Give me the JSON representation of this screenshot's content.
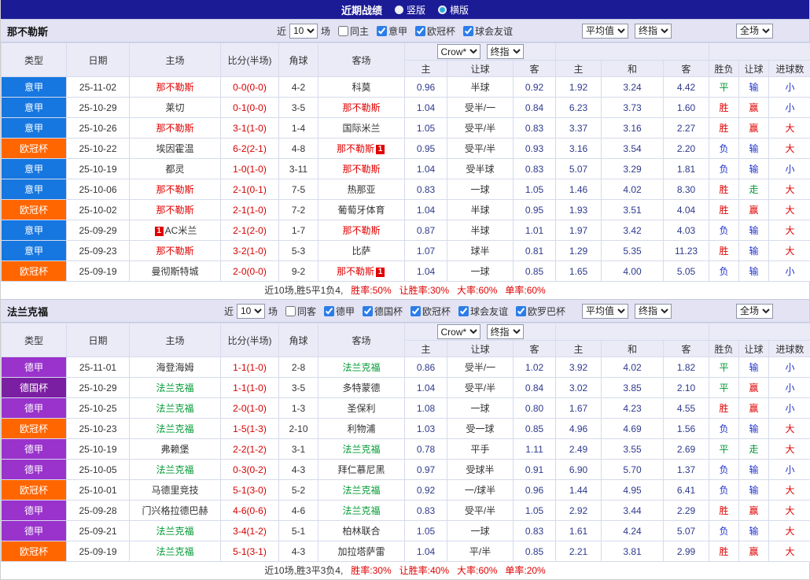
{
  "topbar": {
    "title": "近期战绩",
    "radio_vertical": "竖版",
    "radio_horizontal": "横版",
    "selected": "横版"
  },
  "colors": {
    "topbar-bg": "#1b1b96",
    "band-bg": "#e3e3f4",
    "header-bg": "#ebebf8",
    "border": "#c3c9e0",
    "grid": "#d6dbec",
    "red": "#e00000",
    "blue": "#2233cc",
    "green": "#009933",
    "score": "#d40000",
    "odds": "#2e3a8c",
    "radio-dot": "#2aa9e0"
  },
  "league_colors": {
    "意甲": "#1677e0",
    "欧冠杯": "#ff6600",
    "德甲": "#9933cc",
    "德国杯": "#7b1fa2"
  },
  "columns": {
    "main": [
      "类型",
      "日期",
      "主场",
      "比分(半场)",
      "角球",
      "客场"
    ],
    "sub": [
      "主",
      "让球",
      "客",
      "主",
      "和",
      "客",
      "胜负",
      "让球",
      "进球数"
    ]
  },
  "sections": [
    {
      "team": "那不勒斯",
      "focus_color": "#e00000",
      "filters": {
        "near": "近",
        "count": "10",
        "games": "场",
        "checks": [
          {
            "label": "同主",
            "checked": false
          },
          {
            "label": "意甲",
            "checked": true
          },
          {
            "label": "欧冠杯",
            "checked": true
          },
          {
            "label": "球会友谊",
            "checked": true
          }
        ]
      },
      "selects": {
        "odds_source": "Crow*",
        "odds_stage": "终指",
        "avg": "平均值",
        "avg_stage": "终指",
        "scope": "全场"
      },
      "rows": [
        {
          "league": "意甲",
          "date": "25-11-02",
          "home": "那不勒斯",
          "home_focus": true,
          "score": "0-0(0-0)",
          "corner": "4-2",
          "away": "科莫",
          "odds": [
            "0.96",
            "半球",
            "0.92"
          ],
          "avg": [
            "1.92",
            "3.24",
            "4.42"
          ],
          "results": [
            "平",
            "输",
            "小"
          ]
        },
        {
          "league": "意甲",
          "date": "25-10-29",
          "home": "莱切",
          "score": "0-1(0-0)",
          "corner": "3-5",
          "away": "那不勒斯",
          "away_focus": true,
          "odds": [
            "1.04",
            "受半/一",
            "0.84"
          ],
          "avg": [
            "6.23",
            "3.73",
            "1.60"
          ],
          "results": [
            "胜",
            "赢",
            "小"
          ]
        },
        {
          "league": "意甲",
          "date": "25-10-26",
          "home": "那不勒斯",
          "home_focus": true,
          "score": "3-1(1-0)",
          "corner": "1-4",
          "away": "国际米兰",
          "odds": [
            "1.05",
            "受平/半",
            "0.83"
          ],
          "avg": [
            "3.37",
            "3.16",
            "2.27"
          ],
          "results": [
            "胜",
            "赢",
            "大"
          ]
        },
        {
          "league": "欧冠杯",
          "date": "25-10-22",
          "home": "埃因霍温",
          "score": "6-2(2-1)",
          "corner": "4-8",
          "away": "那不勒斯",
          "away_focus": true,
          "away_badge": "1",
          "odds": [
            "0.95",
            "受平/半",
            "0.93"
          ],
          "avg": [
            "3.16",
            "3.54",
            "2.20"
          ],
          "results": [
            "负",
            "输",
            "大"
          ]
        },
        {
          "league": "意甲",
          "date": "25-10-19",
          "home": "都灵",
          "score": "1-0(1-0)",
          "corner": "3-11",
          "away": "那不勒斯",
          "away_focus": true,
          "odds": [
            "1.04",
            "受半球",
            "0.83"
          ],
          "avg": [
            "5.07",
            "3.29",
            "1.81"
          ],
          "results": [
            "负",
            "输",
            "小"
          ]
        },
        {
          "league": "意甲",
          "date": "25-10-06",
          "home": "那不勒斯",
          "home_focus": true,
          "score": "2-1(0-1)",
          "corner": "7-5",
          "away": "热那亚",
          "odds": [
            "0.83",
            "一球",
            "1.05"
          ],
          "avg": [
            "1.46",
            "4.02",
            "8.30"
          ],
          "results": [
            "胜",
            "走",
            "大"
          ]
        },
        {
          "league": "欧冠杯",
          "date": "25-10-02",
          "home": "那不勒斯",
          "home_focus": true,
          "score": "2-1(1-0)",
          "corner": "7-2",
          "away": "葡萄牙体育",
          "odds": [
            "1.04",
            "半球",
            "0.95"
          ],
          "avg": [
            "1.93",
            "3.51",
            "4.04"
          ],
          "results": [
            "胜",
            "赢",
            "大"
          ]
        },
        {
          "league": "意甲",
          "date": "25-09-29",
          "home": "AC米兰",
          "home_badge": "1",
          "home_badge_pos": "before",
          "score": "2-1(2-0)",
          "corner": "1-7",
          "away": "那不勒斯",
          "away_focus": true,
          "odds": [
            "0.87",
            "半球",
            "1.01"
          ],
          "avg": [
            "1.97",
            "3.42",
            "4.03"
          ],
          "results": [
            "负",
            "输",
            "大"
          ]
        },
        {
          "league": "意甲",
          "date": "25-09-23",
          "home": "那不勒斯",
          "home_focus": true,
          "score": "3-2(1-0)",
          "corner": "5-3",
          "away": "比萨",
          "odds": [
            "1.07",
            "球半",
            "0.81"
          ],
          "avg": [
            "1.29",
            "5.35",
            "11.23"
          ],
          "results": [
            "胜",
            "输",
            "大"
          ]
        },
        {
          "league": "欧冠杯",
          "date": "25-09-19",
          "home": "曼彻斯特城",
          "score": "2-0(0-0)",
          "corner": "9-2",
          "away": "那不勒斯",
          "away_focus": true,
          "away_badge": "1",
          "odds": [
            "1.04",
            "一球",
            "0.85"
          ],
          "avg": [
            "1.65",
            "4.00",
            "5.05"
          ],
          "results": [
            "负",
            "输",
            "小"
          ]
        }
      ],
      "summary": {
        "prefix": "近10场,胜5平1负4,",
        "rates": [
          "胜率:50%",
          "让胜率:30%",
          "大率:60%",
          "单率:60%"
        ]
      }
    },
    {
      "team": "法兰克福",
      "focus_color": "#009933",
      "filters": {
        "near": "近",
        "count": "10",
        "games": "场",
        "checks": [
          {
            "label": "同客",
            "checked": false
          },
          {
            "label": "德甲",
            "checked": true
          },
          {
            "label": "德国杯",
            "checked": true
          },
          {
            "label": "欧冠杯",
            "checked": true
          },
          {
            "label": "球会友谊",
            "checked": true
          },
          {
            "label": "欧罗巴杯",
            "checked": true
          }
        ]
      },
      "selects": {
        "odds_source": "Crow*",
        "odds_stage": "终指",
        "avg": "平均值",
        "avg_stage": "终指",
        "scope": "全场"
      },
      "rows": [
        {
          "league": "德甲",
          "date": "25-11-01",
          "home": "海登海姆",
          "score": "1-1(1-0)",
          "corner": "2-8",
          "away": "法兰克福",
          "away_focus": true,
          "odds": [
            "0.86",
            "受半/一",
            "1.02"
          ],
          "avg": [
            "3.92",
            "4.02",
            "1.82"
          ],
          "results": [
            "平",
            "输",
            "小"
          ]
        },
        {
          "league": "德国杯",
          "date": "25-10-29",
          "home": "法兰克福",
          "home_focus": true,
          "score": "1-1(1-0)",
          "corner": "3-5",
          "away": "多特蒙德",
          "odds": [
            "1.04",
            "受平/半",
            "0.84"
          ],
          "avg": [
            "3.02",
            "3.85",
            "2.10"
          ],
          "results": [
            "平",
            "赢",
            "小"
          ]
        },
        {
          "league": "德甲",
          "date": "25-10-25",
          "home": "法兰克福",
          "home_focus": true,
          "score": "2-0(1-0)",
          "corner": "1-3",
          "away": "圣保利",
          "odds": [
            "1.08",
            "一球",
            "0.80"
          ],
          "avg": [
            "1.67",
            "4.23",
            "4.55"
          ],
          "results": [
            "胜",
            "赢",
            "小"
          ]
        },
        {
          "league": "欧冠杯",
          "date": "25-10-23",
          "home": "法兰克福",
          "home_focus": true,
          "score": "1-5(1-3)",
          "corner": "2-10",
          "away": "利物浦",
          "odds": [
            "1.03",
            "受一球",
            "0.85"
          ],
          "avg": [
            "4.96",
            "4.69",
            "1.56"
          ],
          "results": [
            "负",
            "输",
            "大"
          ]
        },
        {
          "league": "德甲",
          "date": "25-10-19",
          "home": "弗赖堡",
          "score": "2-2(1-2)",
          "corner": "3-1",
          "away": "法兰克福",
          "away_focus": true,
          "odds": [
            "0.78",
            "平手",
            "1.11"
          ],
          "avg": [
            "2.49",
            "3.55",
            "2.69"
          ],
          "results": [
            "平",
            "走",
            "大"
          ]
        },
        {
          "league": "德甲",
          "date": "25-10-05",
          "home": "法兰克福",
          "home_focus": true,
          "score": "0-3(0-2)",
          "corner": "4-3",
          "away": "拜仁慕尼黑",
          "odds": [
            "0.97",
            "受球半",
            "0.91"
          ],
          "avg": [
            "6.90",
            "5.70",
            "1.37"
          ],
          "results": [
            "负",
            "输",
            "小"
          ]
        },
        {
          "league": "欧冠杯",
          "date": "25-10-01",
          "home": "马德里竞技",
          "score": "5-1(3-0)",
          "corner": "5-2",
          "away": "法兰克福",
          "away_focus": true,
          "odds": [
            "0.92",
            "一/球半",
            "0.96"
          ],
          "avg": [
            "1.44",
            "4.95",
            "6.41"
          ],
          "results": [
            "负",
            "输",
            "大"
          ]
        },
        {
          "league": "德甲",
          "date": "25-09-28",
          "home": "门兴格拉德巴赫",
          "score": "4-6(0-6)",
          "corner": "4-6",
          "away": "法兰克福",
          "away_focus": true,
          "odds": [
            "0.83",
            "受平/半",
            "1.05"
          ],
          "avg": [
            "2.92",
            "3.44",
            "2.29"
          ],
          "results": [
            "胜",
            "赢",
            "大"
          ]
        },
        {
          "league": "德甲",
          "date": "25-09-21",
          "home": "法兰克福",
          "home_focus": true,
          "score": "3-4(1-2)",
          "corner": "5-1",
          "away": "柏林联合",
          "odds": [
            "1.05",
            "一球",
            "0.83"
          ],
          "avg": [
            "1.61",
            "4.24",
            "5.07"
          ],
          "results": [
            "负",
            "输",
            "大"
          ]
        },
        {
          "league": "欧冠杯",
          "date": "25-09-19",
          "home": "法兰克福",
          "home_focus": true,
          "score": "5-1(3-1)",
          "corner": "4-3",
          "away": "加拉塔萨雷",
          "odds": [
            "1.04",
            "平/半",
            "0.85"
          ],
          "avg": [
            "2.21",
            "3.81",
            "2.99"
          ],
          "results": [
            "胜",
            "赢",
            "大"
          ]
        }
      ],
      "summary": {
        "prefix": "近10场,胜3平3负4,",
        "rates": [
          "胜率:30%",
          "让胜率:40%",
          "大率:60%",
          "单率:20%"
        ]
      }
    }
  ]
}
